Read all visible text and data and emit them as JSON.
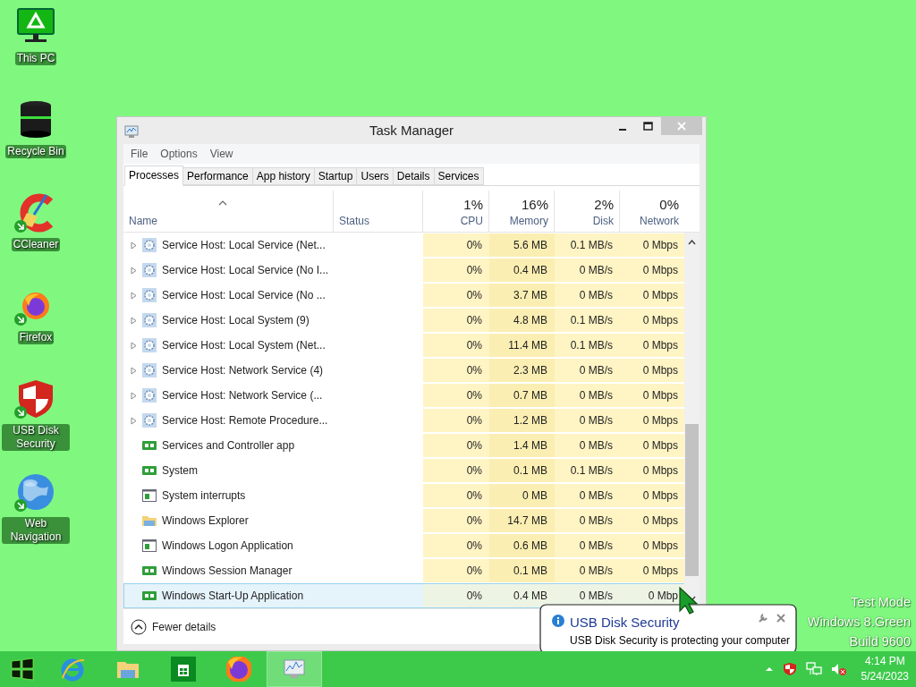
{
  "desktop_icons": [
    {
      "label": "This PC",
      "kind": "monitor",
      "shortcut": false
    },
    {
      "label": "Recycle Bin",
      "kind": "bin",
      "shortcut": false
    },
    {
      "label": "CCleaner",
      "kind": "ccleaner",
      "shortcut": true
    },
    {
      "label": "Firefox",
      "kind": "firefox",
      "shortcut": true
    },
    {
      "label": "USB Disk Security",
      "kind": "shield",
      "shortcut": true
    },
    {
      "label": "Web Navigation",
      "kind": "globe",
      "shortcut": true
    }
  ],
  "window": {
    "title": "Task Manager",
    "menu": [
      "File",
      "Options",
      "View"
    ],
    "tabs": [
      {
        "label": "Processes",
        "selected": true
      },
      {
        "label": "Performance",
        "selected": false
      },
      {
        "label": "App history",
        "selected": false
      },
      {
        "label": "Startup",
        "selected": false
      },
      {
        "label": "Users",
        "selected": false
      },
      {
        "label": "Details",
        "selected": false
      },
      {
        "label": "Services",
        "selected": false
      }
    ],
    "columns": [
      {
        "label": "Name"
      },
      {
        "label": "Status"
      },
      {
        "percent": "1%",
        "label": "CPU"
      },
      {
        "percent": "16%",
        "label": "Memory"
      },
      {
        "percent": "2%",
        "label": "Disk"
      },
      {
        "percent": "0%",
        "label": "Network"
      }
    ],
    "rows": [
      {
        "name": "Service Host: Local Service (Net...",
        "kind": "service",
        "expandable": true,
        "selected": false,
        "cpu": "0%",
        "memory": "5.6 MB",
        "disk": "0.1 MB/s",
        "network": "0 Mbps"
      },
      {
        "name": "Service Host: Local Service (No I...",
        "kind": "service",
        "expandable": true,
        "selected": false,
        "cpu": "0%",
        "memory": "0.4 MB",
        "disk": "0 MB/s",
        "network": "0 Mbps"
      },
      {
        "name": "Service Host: Local Service (No ...",
        "kind": "service",
        "expandable": true,
        "selected": false,
        "cpu": "0%",
        "memory": "3.7 MB",
        "disk": "0 MB/s",
        "network": "0 Mbps"
      },
      {
        "name": "Service Host: Local System (9)",
        "kind": "service",
        "expandable": true,
        "selected": false,
        "cpu": "0%",
        "memory": "4.8 MB",
        "disk": "0.1 MB/s",
        "network": "0 Mbps"
      },
      {
        "name": "Service Host: Local System (Net...",
        "kind": "service",
        "expandable": true,
        "selected": false,
        "cpu": "0%",
        "memory": "11.4 MB",
        "disk": "0.1 MB/s",
        "network": "0 Mbps"
      },
      {
        "name": "Service Host: Network Service (4)",
        "kind": "service",
        "expandable": true,
        "selected": false,
        "cpu": "0%",
        "memory": "2.3 MB",
        "disk": "0 MB/s",
        "network": "0 Mbps"
      },
      {
        "name": "Service Host: Network Service (...",
        "kind": "service",
        "expandable": true,
        "selected": false,
        "cpu": "0%",
        "memory": "0.7 MB",
        "disk": "0 MB/s",
        "network": "0 Mbps"
      },
      {
        "name": "Service Host: Remote Procedure...",
        "kind": "service",
        "expandable": true,
        "selected": false,
        "cpu": "0%",
        "memory": "1.2 MB",
        "disk": "0 MB/s",
        "network": "0 Mbps"
      },
      {
        "name": "Services and Controller app",
        "kind": "app",
        "expandable": false,
        "selected": false,
        "cpu": "0%",
        "memory": "1.4 MB",
        "disk": "0 MB/s",
        "network": "0 Mbps"
      },
      {
        "name": "System",
        "kind": "app",
        "expandable": false,
        "selected": false,
        "cpu": "0%",
        "memory": "0.1 MB",
        "disk": "0.1 MB/s",
        "network": "0 Mbps"
      },
      {
        "name": "System interrupts",
        "kind": "window",
        "expandable": false,
        "selected": false,
        "cpu": "0%",
        "memory": "0 MB",
        "disk": "0 MB/s",
        "network": "0 Mbps"
      },
      {
        "name": "Windows Explorer",
        "kind": "folder",
        "expandable": false,
        "selected": false,
        "cpu": "0%",
        "memory": "14.7 MB",
        "disk": "0 MB/s",
        "network": "0 Mbps"
      },
      {
        "name": "Windows Logon Application",
        "kind": "window",
        "expandable": false,
        "selected": false,
        "cpu": "0%",
        "memory": "0.6 MB",
        "disk": "0 MB/s",
        "network": "0 Mbps"
      },
      {
        "name": "Windows Session Manager",
        "kind": "app",
        "expandable": false,
        "selected": false,
        "cpu": "0%",
        "memory": "0.1 MB",
        "disk": "0 MB/s",
        "network": "0 Mbps"
      },
      {
        "name": "Windows Start-Up Application",
        "kind": "app",
        "expandable": false,
        "selected": true,
        "cpu": "0%",
        "memory": "0.4 MB",
        "disk": "0 MB/s",
        "network": "0 Mbp"
      }
    ],
    "fewer_details": "Fewer details"
  },
  "notification": {
    "title": "USB Disk Security",
    "message": "USB Disk Security is protecting your computer"
  },
  "watermark": [
    "Test Mode",
    "Windows 8.Green",
    "Build 9600"
  ],
  "taskbar": {
    "apps": [
      {
        "kind": "start",
        "active": false
      },
      {
        "kind": "ie",
        "active": false
      },
      {
        "kind": "explorer",
        "active": false
      },
      {
        "kind": "store",
        "active": false
      },
      {
        "kind": "firefox",
        "active": false
      },
      {
        "kind": "taskmanager",
        "active": true
      }
    ],
    "clock": {
      "time": "4:14 PM",
      "date": "5/24/2023"
    }
  }
}
